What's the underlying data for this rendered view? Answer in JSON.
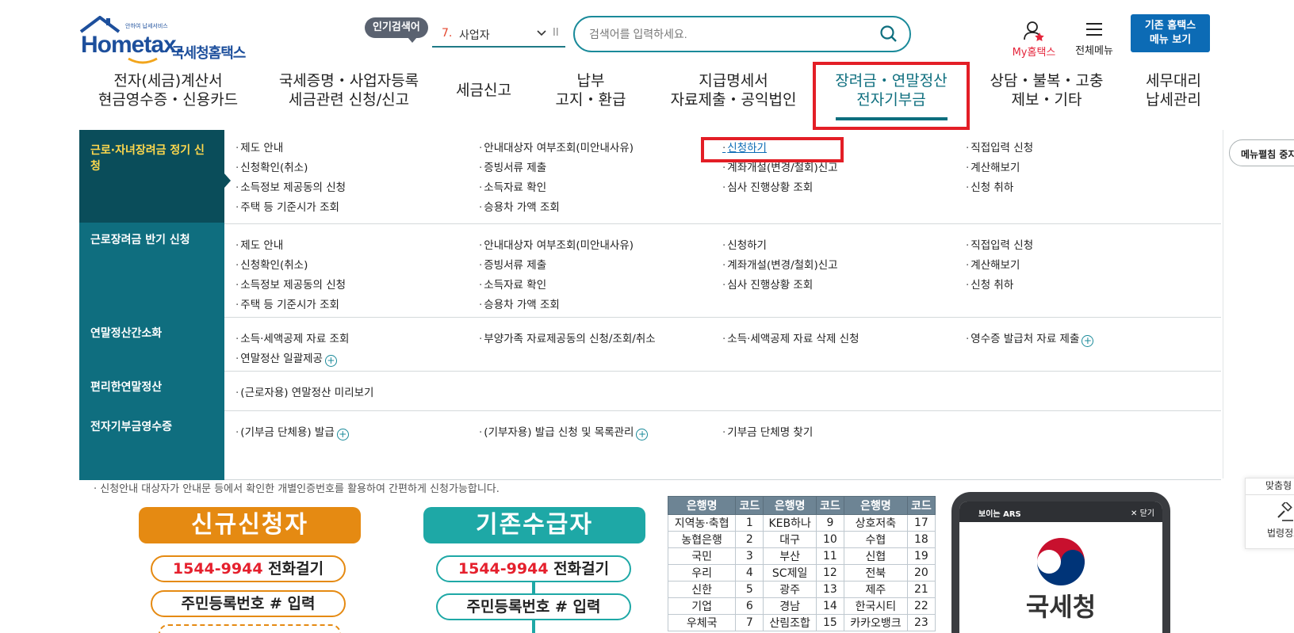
{
  "header": {
    "logo_small": "안하여 납세서비스",
    "logo_word": "Hometax.",
    "logo_kor": "국세청홈택스",
    "popular_badge": "인기검색어",
    "popular_rank": "7.",
    "popular_term": "사업자",
    "pause_glyph": "II",
    "search_placeholder": "검색어를 입력하세요.",
    "my_hometax": "My홈택스",
    "all_menu": "전체메뉴",
    "old_hometax_1": "기존 홈택스",
    "old_hometax_2": "메뉴 보기"
  },
  "gnb": [
    {
      "l1": "전자(세금)계산서",
      "l2": "현금영수증・신용카드"
    },
    {
      "l1": "국세증명・사업자등록",
      "l2": "세금관련 신청/신고"
    },
    {
      "l1": "세금신고",
      "l2": ""
    },
    {
      "l1": "납부",
      "l2": "고지・환급"
    },
    {
      "l1": "지급명세서",
      "l2": "자료제출・공익법인"
    },
    {
      "l1": "장려금・연말정산",
      "l2": "전자기부금"
    },
    {
      "l1": "상담・불복・고충",
      "l2": "제보・기타"
    },
    {
      "l1": "세무대리",
      "l2": "납세관리"
    }
  ],
  "categories": [
    {
      "name": "근로·자녀장려금 정기 신청"
    },
    {
      "name": "근로장려금 반기 신청"
    },
    {
      "name": "연말정산간소화"
    },
    {
      "name": "편리한연말정산"
    },
    {
      "name": "전자기부금영수증"
    }
  ],
  "links": {
    "s1": [
      "제도 안내",
      "신청확인(취소)",
      "소득정보 제공동의 신청",
      "주택 등 기준시가 조회",
      "안내대상자 여부조회(미안내사유)",
      "증빙서류 제출",
      "소득자료 확인",
      "승용차 가액 조회",
      "신청하기",
      "계좌개설(변경/철회)신고",
      "심사 진행상황 조회",
      "직접입력 신청",
      "계산해보기",
      "신청 취하"
    ],
    "s2": [
      "제도 안내",
      "신청확인(취소)",
      "소득정보 제공동의 신청",
      "주택 등 기준시가 조회",
      "안내대상자 여부조회(미안내사유)",
      "증빙서류 제출",
      "소득자료 확인",
      "승용차 가액 조회",
      "신청하기",
      "계좌개설(변경/철회)신고",
      "심사 진행상황 조회",
      "직접입력 신청",
      "계산해보기",
      "신청 취하"
    ],
    "s3": [
      "소득·세액공제 자료 조회",
      "연말정산 일괄제공",
      "부양가족 자료제공동의 신청/조회/취소",
      "소득·세액공제 자료 삭제 신청",
      "영수증 발급처 자료 제출"
    ],
    "s4": [
      "(근로자용) 연말정산 미리보기"
    ],
    "s5": [
      "(기부금 단체용) 발급",
      "(기부자용) 발급 신청 및 목록관리",
      "기부금 단체명 찾기"
    ]
  },
  "menu_fold": "메뉴펼침 중지",
  "below": {
    "notice": "· 신청안내 대상자가 안내문 등에서 확인한 개별인증번호를 활용하여 간편하게 신청가능합니다.",
    "new_applicant": "신규신청자",
    "existing_recipient": "기존수급자",
    "phone_number": "1544-9944",
    "call_suffix": " 전화걸기",
    "rrn_step": "주민등록번호 # 입력",
    "table_headers": [
      "은행명",
      "코드",
      "은행명",
      "코드",
      "은행명",
      "코드"
    ],
    "table_rows": [
      [
        "지역농·축협",
        "1",
        "KEB하나",
        "9",
        "상호저축",
        "17"
      ],
      [
        "농협은행",
        "2",
        "대구",
        "10",
        "수협",
        "18"
      ],
      [
        "국민",
        "3",
        "부산",
        "11",
        "신협",
        "19"
      ],
      [
        "우리",
        "4",
        "SC제일",
        "12",
        "전북",
        "20"
      ],
      [
        "신한",
        "5",
        "광주",
        "13",
        "제주",
        "21"
      ],
      [
        "기업",
        "6",
        "경남",
        "14",
        "한국시티",
        "22"
      ],
      [
        "우체국",
        "7",
        "산림조합",
        "15",
        "카카오뱅크",
        "23"
      ]
    ],
    "ars_title": "보이는 ARS",
    "ars_close": "닫기",
    "ars_org": "국세청",
    "quick_1": "맞춤형",
    "quick_2": "법령정보"
  },
  "colors": {
    "teal": "#0f6e7f",
    "teal_dark": "#0a4d5a",
    "highlight": "#e31e26",
    "orange": "#e58a12",
    "green": "#1ea8a6"
  }
}
